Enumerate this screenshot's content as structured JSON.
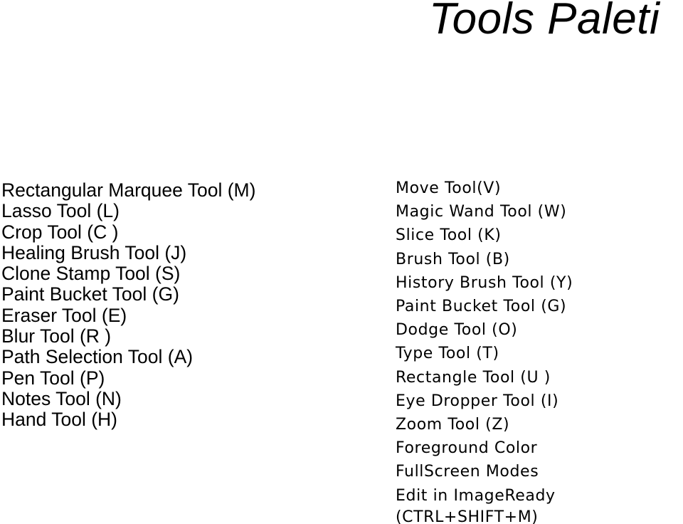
{
  "slide": {
    "background_color": "#ffffff",
    "text_color": "#000000",
    "title": "Tools Paleti"
  },
  "left_column": {
    "items": [
      {
        "label": "Rectangular Marquee Tool (M)"
      },
      {
        "label": "Lasso Tool (L)"
      },
      {
        "label": "Crop Tool (C )"
      },
      {
        "label": "Healing Brush Tool (J)"
      },
      {
        "label": "Clone Stamp Tool (S)"
      },
      {
        "label": "Paint Bucket Tool (G)"
      },
      {
        "label": "Eraser Tool (E)"
      },
      {
        "label": "Blur Tool (R )"
      },
      {
        "label": "Path Selection Tool (A)"
      },
      {
        "label": "Pen Tool (P)"
      },
      {
        "label": "Notes Tool (N)"
      },
      {
        "label": "Hand Tool (H)"
      }
    ]
  },
  "right_column": {
    "items": [
      {
        "label": "Move Tool(V)"
      },
      {
        "label": "Magic Wand Tool (W)"
      },
      {
        "label": "Slice Tool (K)"
      },
      {
        "label": "Brush Tool (B)"
      },
      {
        "label": "History Brush Tool (Y)"
      },
      {
        "label": "Paint Bucket Tool (G)"
      },
      {
        "label": "Dodge Tool (O)"
      },
      {
        "label": "Type Tool (T)"
      },
      {
        "label": "Rectangle Tool (U )"
      },
      {
        "label": "Eye Dropper Tool (I)"
      },
      {
        "label": "Zoom Tool (Z)"
      },
      {
        "label": "Foreground Color"
      },
      {
        "label": "FullScreen Modes"
      },
      {
        "label": "Edit in ImageReady"
      },
      {
        "label": "(CTRL+SHIFT+M)"
      }
    ]
  }
}
